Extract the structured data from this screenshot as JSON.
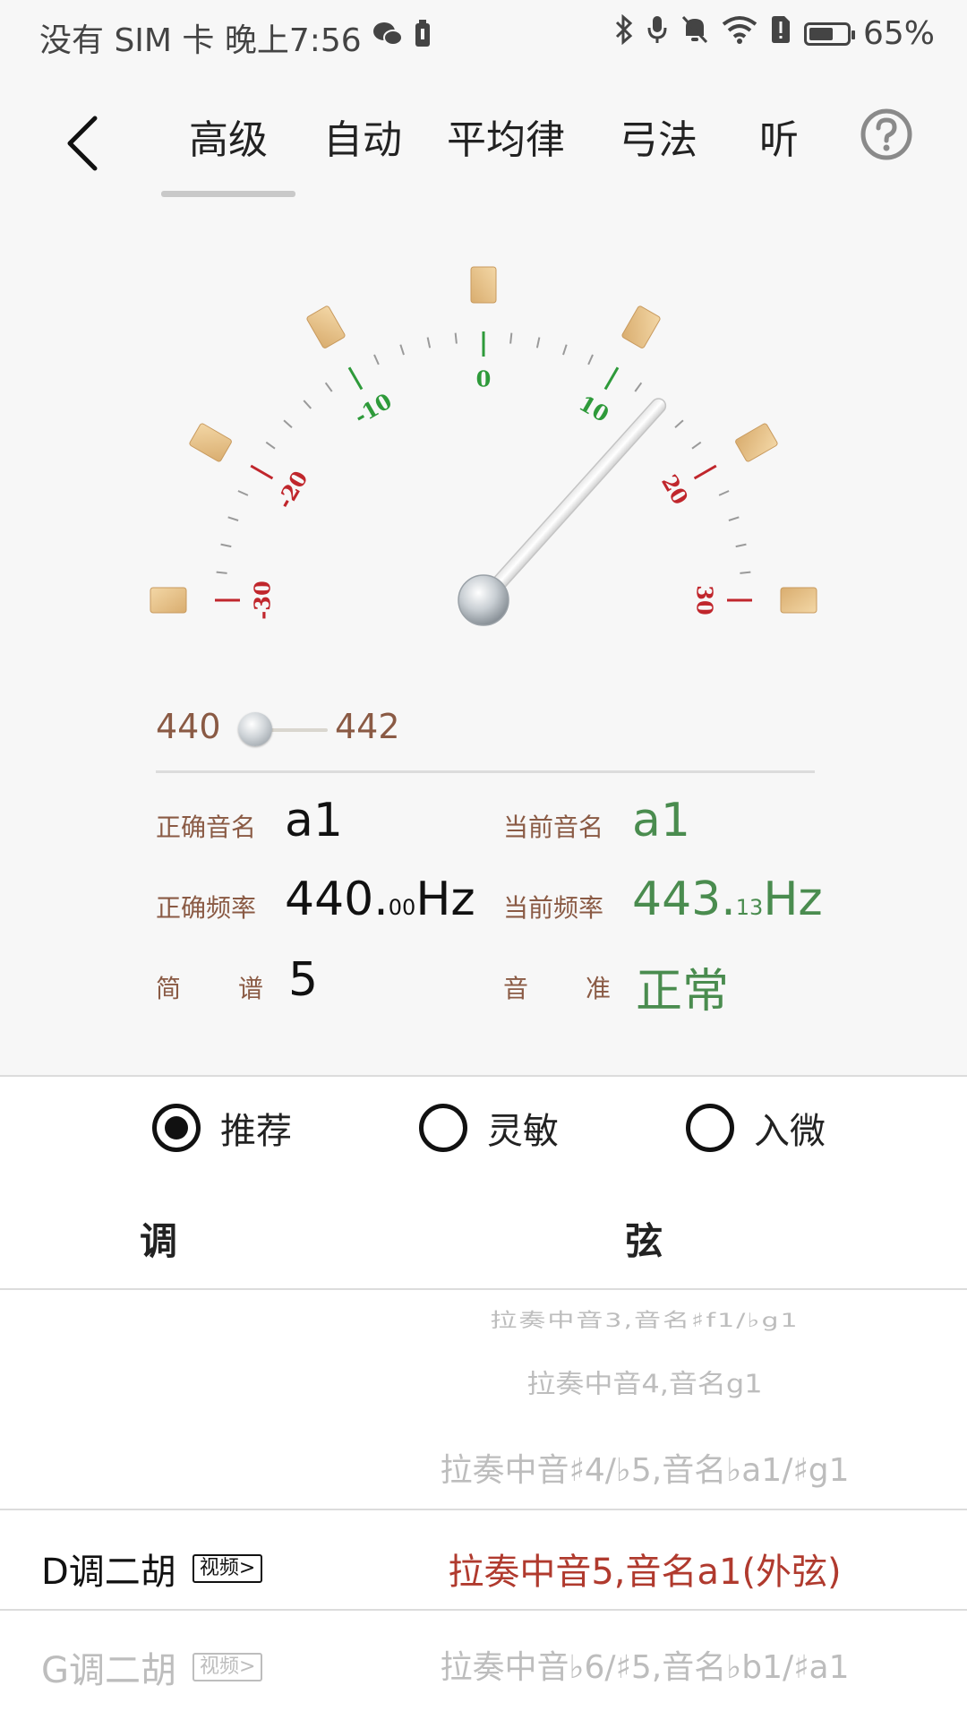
{
  "status_bar": {
    "left_text": "没有 SIM 卡 晚上7:56",
    "battery_percent_text": "65%",
    "battery_level": 0.65,
    "icons": [
      "wechat-icon",
      "battery-saver-icon",
      "bluetooth-icon",
      "mic-icon",
      "mute-icon",
      "wifi-icon",
      "sim-alert-icon",
      "battery-icon"
    ]
  },
  "header": {
    "tabs": [
      "高级",
      "自动",
      "平均律",
      "弓法",
      "听"
    ],
    "active_tab": 0
  },
  "gauge": {
    "scale_labels": [
      "-30",
      "-20",
      "-10",
      "0",
      "10",
      "20",
      "30"
    ],
    "needle_value": 14,
    "min": -30,
    "max": 30,
    "green_color": "#2e9a3a",
    "red_color": "#c0262c"
  },
  "reference": {
    "low_label": "440",
    "high_label": "442",
    "position": 0.0
  },
  "readout": {
    "correct_name_label": "正确音名",
    "correct_name_value": "a1",
    "current_name_label": "当前音名",
    "current_name_value": "a1",
    "correct_freq_label": "正确频率",
    "correct_freq_int": "440.",
    "correct_freq_dec": "00",
    "correct_freq_unit": "Hz",
    "current_freq_label": "当前频率",
    "current_freq_int": "443.",
    "current_freq_dec": "13",
    "current_freq_unit": "Hz",
    "jianpu_label_a": "简",
    "jianpu_label_b": "谱",
    "jianpu_value": "5",
    "pitch_label_a": "音",
    "pitch_label_b": "准",
    "pitch_value": "正常"
  },
  "modes": {
    "options": [
      "推荐",
      "灵敏",
      "入微"
    ],
    "selected": 0
  },
  "table": {
    "col_key": "调",
    "col_string": "弦"
  },
  "picker": {
    "rows": [
      {
        "key": "",
        "badge": "",
        "string": "拉奏中音3,音名♯f1/♭g1"
      },
      {
        "key": "",
        "badge": "",
        "string": "拉奏中音4,音名g1"
      },
      {
        "key": "",
        "badge": "",
        "string": "拉奏中音♯4/♭5,音名♭a1/♯g1"
      },
      {
        "key": "D调二胡",
        "badge": "视频>",
        "string": "拉奏中音5,音名a1(外弦)"
      },
      {
        "key": "G调二胡",
        "badge": "视频>",
        "string": "拉奏中音♭6/♯5,音名♭b1/♯a1"
      }
    ],
    "selected_index": 3,
    "selected_color": "#b03a2e",
    "faded_color": "#bdbdbd"
  }
}
